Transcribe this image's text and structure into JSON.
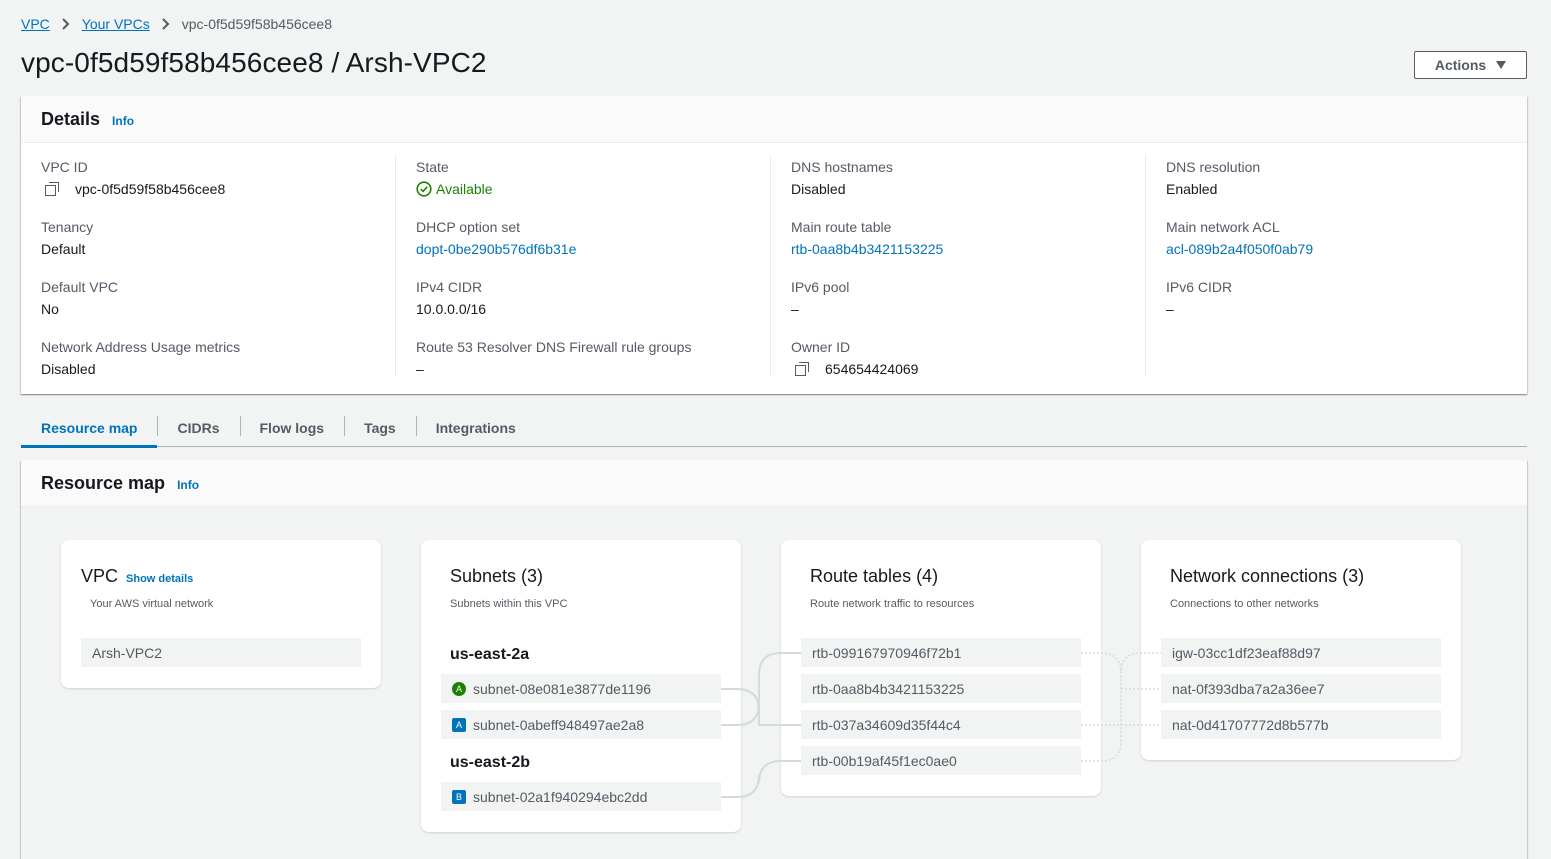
{
  "breadcrumb": {
    "items": [
      "VPC",
      "Your VPCs"
    ],
    "current": "vpc-0f5d59f58b456cee8"
  },
  "page_title": "vpc-0f5d59f58b456cee8 / Arsh-VPC2",
  "actions_label": "Actions",
  "details": {
    "title": "Details",
    "info": "Info",
    "fields": {
      "vpc_id": {
        "label": "VPC ID",
        "value": "vpc-0f5d59f58b456cee8"
      },
      "state": {
        "label": "State",
        "value": "Available"
      },
      "dns_hostnames": {
        "label": "DNS hostnames",
        "value": "Disabled"
      },
      "dns_resolution": {
        "label": "DNS resolution",
        "value": "Enabled"
      },
      "tenancy": {
        "label": "Tenancy",
        "value": "Default"
      },
      "dhcp": {
        "label": "DHCP option set",
        "value": "dopt-0be290b576df6b31e"
      },
      "main_route_table": {
        "label": "Main route table",
        "value": "rtb-0aa8b4b3421153225"
      },
      "main_acl": {
        "label": "Main network ACL",
        "value": "acl-089b2a4f050f0ab79"
      },
      "default_vpc": {
        "label": "Default VPC",
        "value": "No"
      },
      "ipv4_cidr": {
        "label": "IPv4 CIDR",
        "value": "10.0.0.0/16"
      },
      "ipv6_pool": {
        "label": "IPv6 pool",
        "value": "–"
      },
      "ipv6_cidr": {
        "label": "IPv6 CIDR",
        "value": "–"
      },
      "nau_metrics": {
        "label": "Network Address Usage metrics",
        "value": "Disabled"
      },
      "route53": {
        "label": "Route 53 Resolver DNS Firewall rule groups",
        "value": "–"
      },
      "owner_id": {
        "label": "Owner ID",
        "value": "654654424069"
      }
    }
  },
  "tabs": [
    "Resource map",
    "CIDRs",
    "Flow logs",
    "Tags",
    "Integrations"
  ],
  "resource_map": {
    "title": "Resource map",
    "info": "Info",
    "vpc_card": {
      "title": "VPC",
      "show_details": "Show details",
      "subtitle": "Your AWS virtual network",
      "items": [
        "Arsh-VPC2"
      ]
    },
    "subnets_card": {
      "title": "Subnets (3)",
      "subtitle": "Subnets within this VPC",
      "azs": [
        {
          "name": "us-east-2a",
          "subnets": [
            {
              "badge": "A",
              "badge_style": "green",
              "name": "subnet-08e081e3877de1196"
            },
            {
              "badge": "A",
              "badge_style": "blue",
              "name": "subnet-0abeff948497ae2a8"
            }
          ]
        },
        {
          "name": "us-east-2b",
          "subnets": [
            {
              "badge": "B",
              "badge_style": "blue",
              "name": "subnet-02a1f940294ebc2dd"
            }
          ]
        }
      ]
    },
    "route_tables_card": {
      "title": "Route tables (4)",
      "subtitle": "Route network traffic to resources",
      "items": [
        "rtb-099167970946f72b1",
        "rtb-0aa8b4b3421153225",
        "rtb-037a34609d35f44c4",
        "rtb-00b19af45f1ec0ae0"
      ]
    },
    "network_connections_card": {
      "title": "Network connections (3)",
      "subtitle": "Connections to other networks",
      "items": [
        "igw-03cc1df23eaf88d97",
        "nat-0f393dba7a2a36ee7",
        "nat-0d41707772d8b577b"
      ]
    }
  },
  "colors": {
    "link": "#0073bb",
    "available": "#1d8102",
    "background": "#f2f3f3"
  }
}
